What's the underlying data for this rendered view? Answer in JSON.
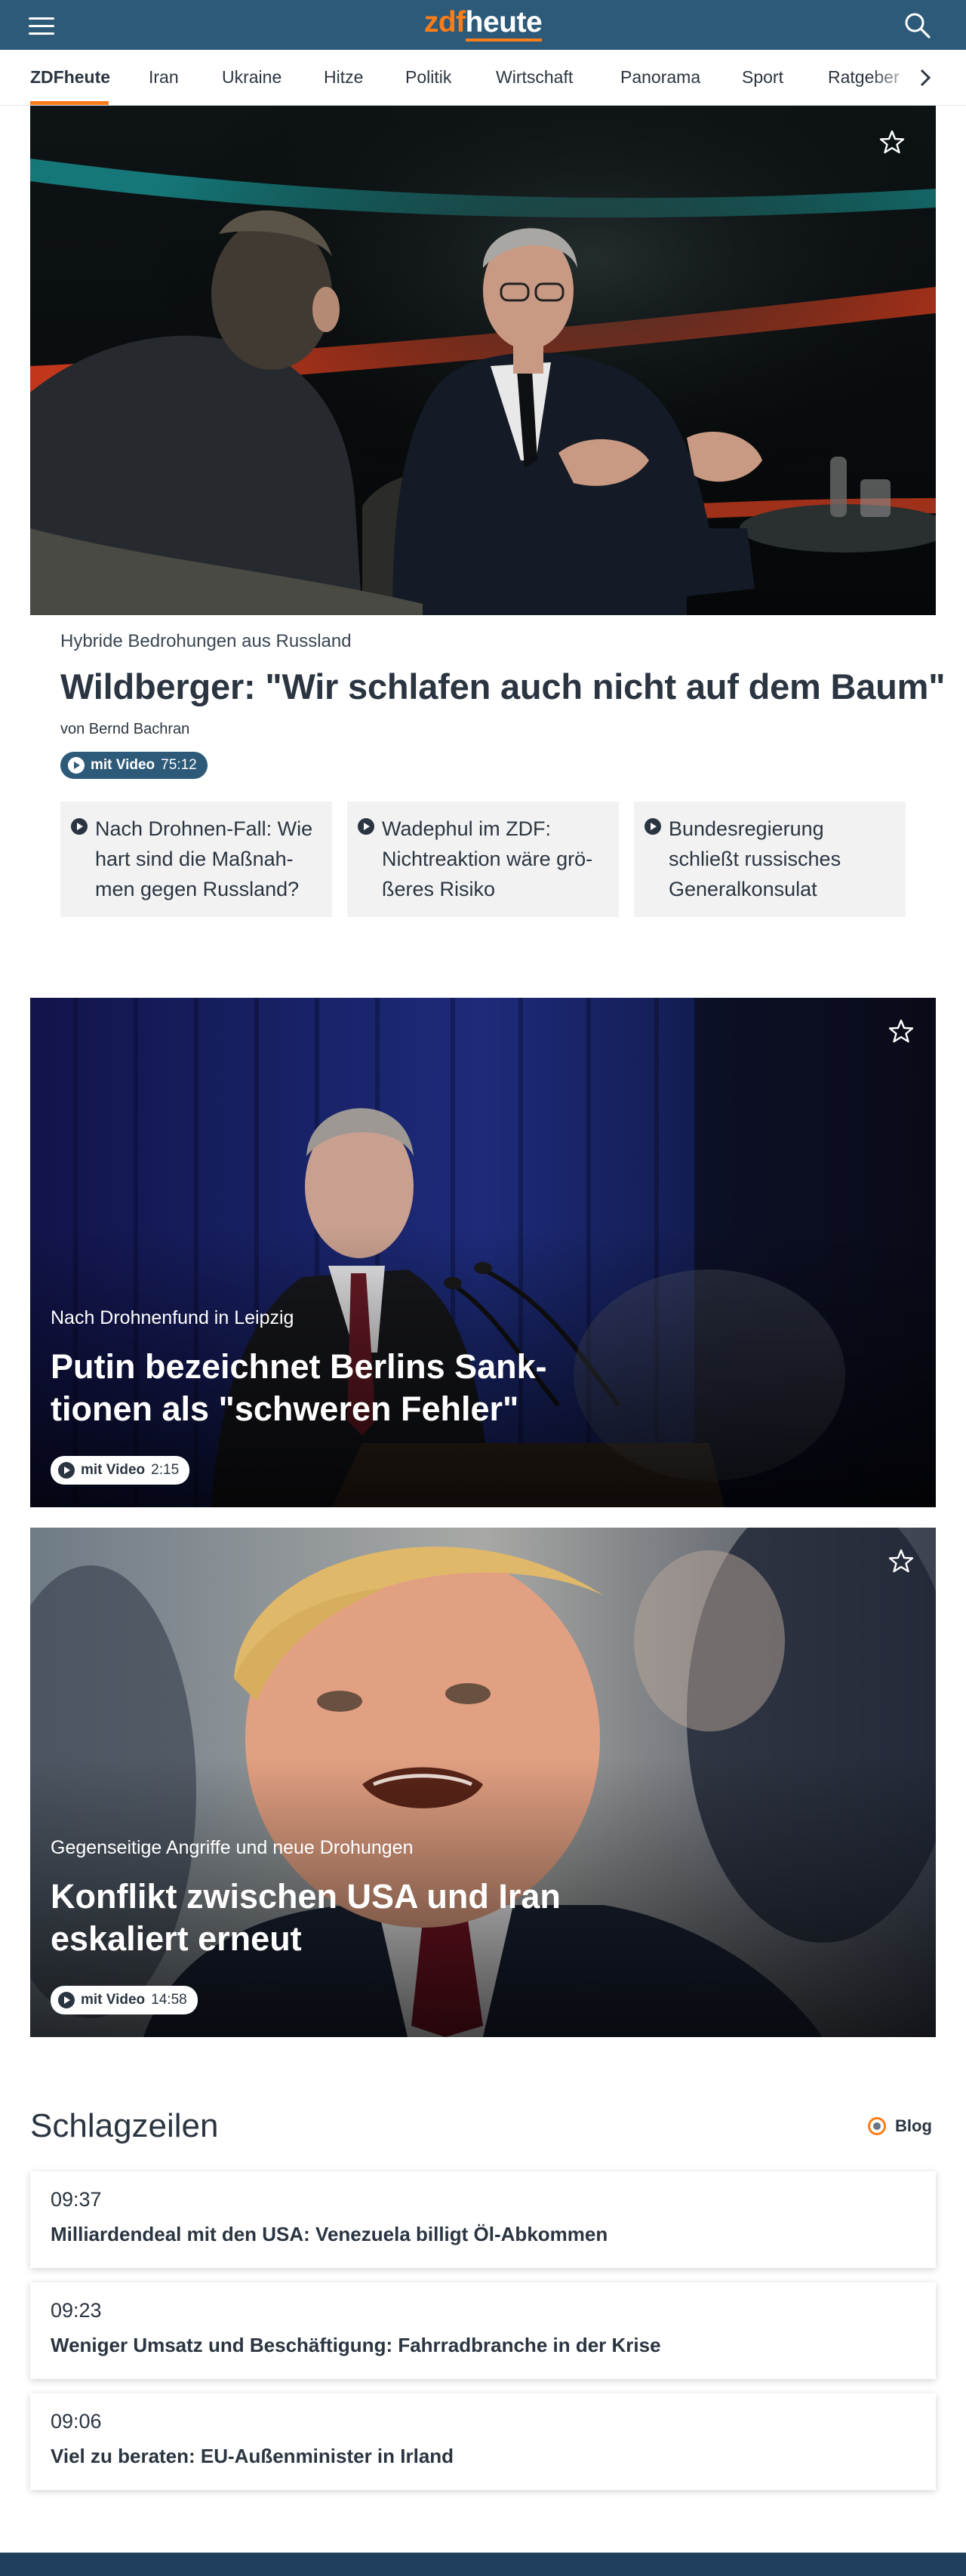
{
  "header": {
    "logo_part1": "zdf",
    "logo_part2": "heute",
    "colors": {
      "bar": "#2e5a7a",
      "accent": "#fa7d19"
    }
  },
  "nav": {
    "items": [
      "ZDFheute",
      "Iran",
      "Ukraine",
      "Hitze",
      "Politik",
      "Wirtschaft",
      "Panorama",
      "Sport",
      "Ratgeber"
    ],
    "active": "ZDFheute"
  },
  "lead": {
    "overline": "Hybride Bedrohungen aus Russland",
    "headline": "Wildberger: \"Wir schlafen auch nicht auf dem Baum\"",
    "byline": "von Bernd Bachran",
    "video_label": "mit Video",
    "video_duration": "75:12",
    "related": [
      {
        "text": "Nach Drohnen-Fall: Wie hart sind die Maßnah-men gegen Russland?"
      },
      {
        "text": "Wadephul im ZDF: Nichtreaktion wäre grö-ßeres Risiko"
      },
      {
        "text": "Bundesregierung schließt russisches Generalkonsulat"
      }
    ]
  },
  "teasers": [
    {
      "overline": "Nach Drohnenfund in Leipzig",
      "headline_line1": "Putin bezeichnet Berlins Sank-",
      "headline_line2": "tionen als \"schweren Fehler\"",
      "video_label": "mit Video",
      "video_duration": "2:15"
    },
    {
      "overline": "Gegenseitige Angriffe und neue Drohungen",
      "headline_line1": "Konflikt zwischen USA und Iran",
      "headline_line2": "eskaliert erneut",
      "video_label": "mit Video",
      "video_duration": "14:58"
    }
  ],
  "schlagzeilen": {
    "title": "Schlagzeilen",
    "blog_label": "Blog",
    "items": [
      {
        "time": "09:37",
        "headline": "Milliardendeal mit den USA: Venezuela billigt Öl-Abkommen"
      },
      {
        "time": "09:23",
        "headline": "Weniger Umsatz und Beschäftigung: Fahrradbranche in der Krise"
      },
      {
        "time": "09:06",
        "headline": "Viel zu beraten: EU-Außenminister in Irland"
      }
    ]
  }
}
